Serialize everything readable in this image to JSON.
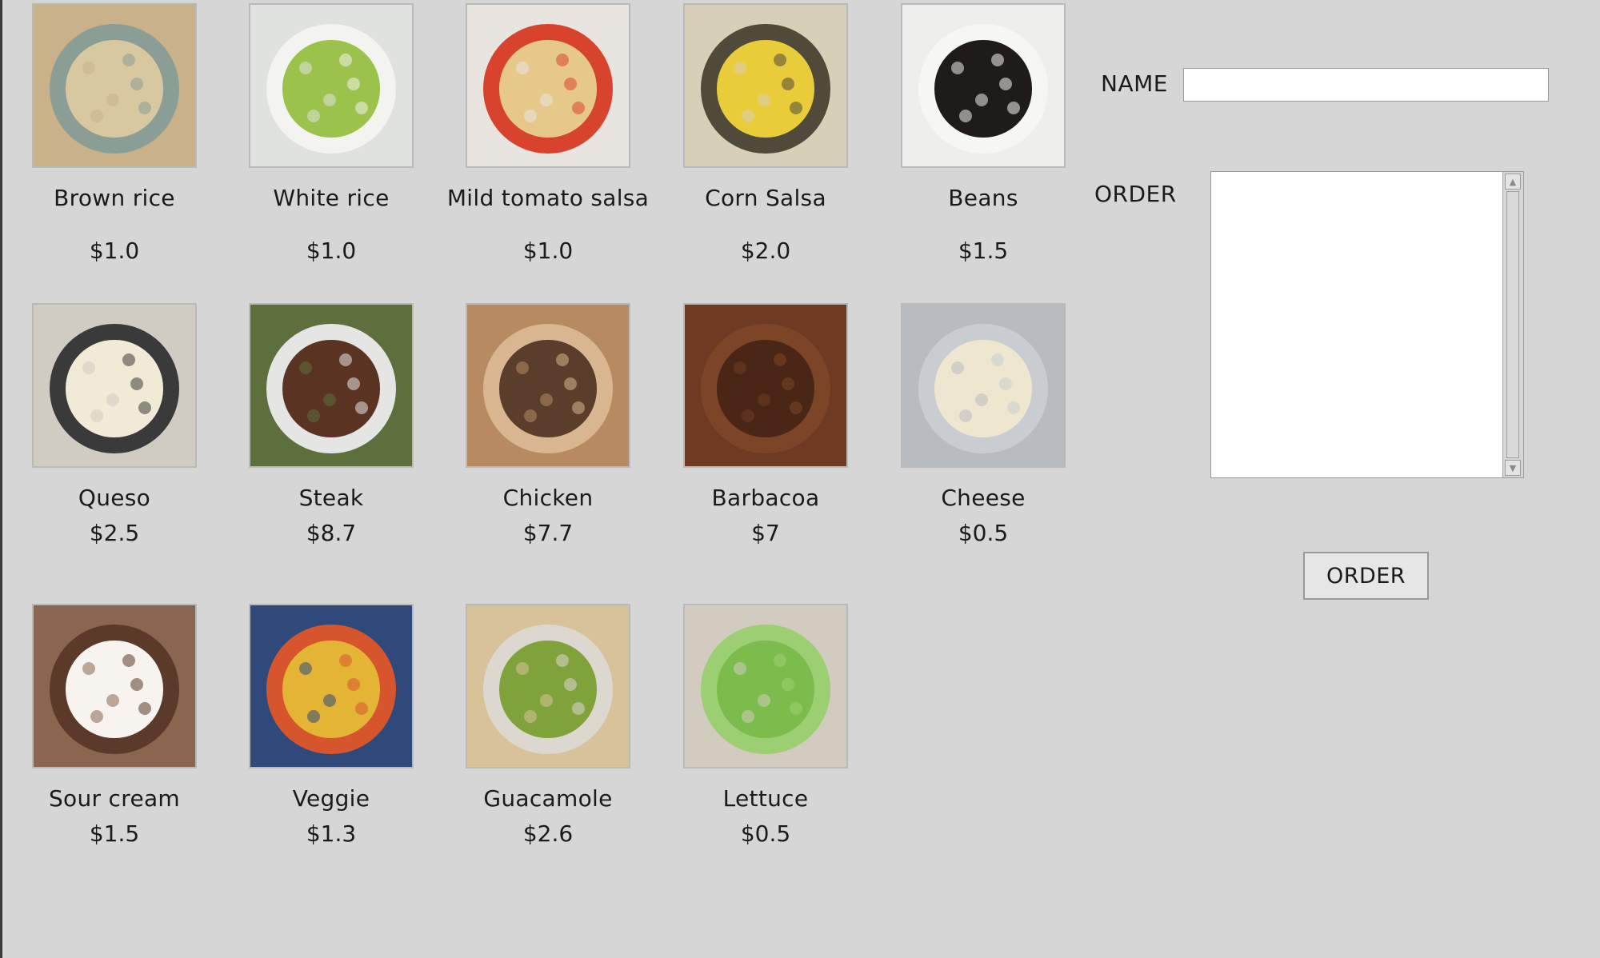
{
  "menu": {
    "items": [
      {
        "name": "Brown rice",
        "price": "$1.0",
        "icon": "brown-rice-image",
        "colors": [
          "#c9b18a",
          "#8a9e95",
          "#d8c8a0"
        ]
      },
      {
        "name": "White rice",
        "price": "$1.0",
        "icon": "white-rice-image",
        "colors": [
          "#dfe2df",
          "#f3f3f0",
          "#9bc24a"
        ]
      },
      {
        "name": "Mild tomato salsa",
        "price": "$1.0",
        "icon": "tomato-salsa-image",
        "colors": [
          "#e8e4e0",
          "#d8432e",
          "#e6c98a"
        ]
      },
      {
        "name": "Corn Salsa",
        "price": "$2.0",
        "icon": "corn-salsa-image",
        "colors": [
          "#d7cfb8",
          "#4f4a3a",
          "#e9cc3a"
        ]
      },
      {
        "name": "Beans",
        "price": "$1.5",
        "icon": "black-beans-image",
        "colors": [
          "#eeeeec",
          "#f6f6f4",
          "#1f1b1b"
        ]
      },
      {
        "name": "Queso",
        "price": "$2.5",
        "icon": "queso-image",
        "colors": [
          "#d0ccc2",
          "#3a3a3a",
          "#f1ead6"
        ]
      },
      {
        "name": "Steak",
        "price": "$8.7",
        "icon": "steak-image",
        "colors": [
          "#5d6f3d",
          "#e5e5e3",
          "#5a3322"
        ]
      },
      {
        "name": "Chicken",
        "price": "$7.7",
        "icon": "chicken-image",
        "colors": [
          "#b88a62",
          "#d9b68f",
          "#5a3d2a"
        ]
      },
      {
        "name": "Barbacoa",
        "price": "$7",
        "icon": "barbacoa-image",
        "colors": [
          "#6e3b22",
          "#7d4528",
          "#4a2616"
        ]
      },
      {
        "name": "Cheese",
        "price": "$0.5",
        "icon": "cheese-image",
        "colors": [
          "#b8bcc0",
          "#c9cdd2",
          "#efe6cf"
        ]
      },
      {
        "name": "Sour cream",
        "price": "$1.5",
        "icon": "sour-cream-image",
        "colors": [
          "#8a6651",
          "#5b3a2a",
          "#f7f4ef"
        ]
      },
      {
        "name": "Veggie",
        "price": "$1.3",
        "icon": "fajita-veggies-image",
        "colors": [
          "#2f4a7a",
          "#d7552c",
          "#e4b535"
        ]
      },
      {
        "name": "Guacamole",
        "price": "$2.6",
        "icon": "guacamole-image",
        "colors": [
          "#d8c29a",
          "#dcd7cf",
          "#7fa33a"
        ]
      },
      {
        "name": "Lettuce",
        "price": "$0.5",
        "icon": "lettuce-image",
        "colors": [
          "#d2cbc0",
          "#9ccf72",
          "#7cbc4c"
        ]
      }
    ]
  },
  "form": {
    "name_label": "NAME",
    "name_value": "",
    "order_label": "ORDER",
    "order_text": "",
    "order_button_label": "ORDER"
  }
}
